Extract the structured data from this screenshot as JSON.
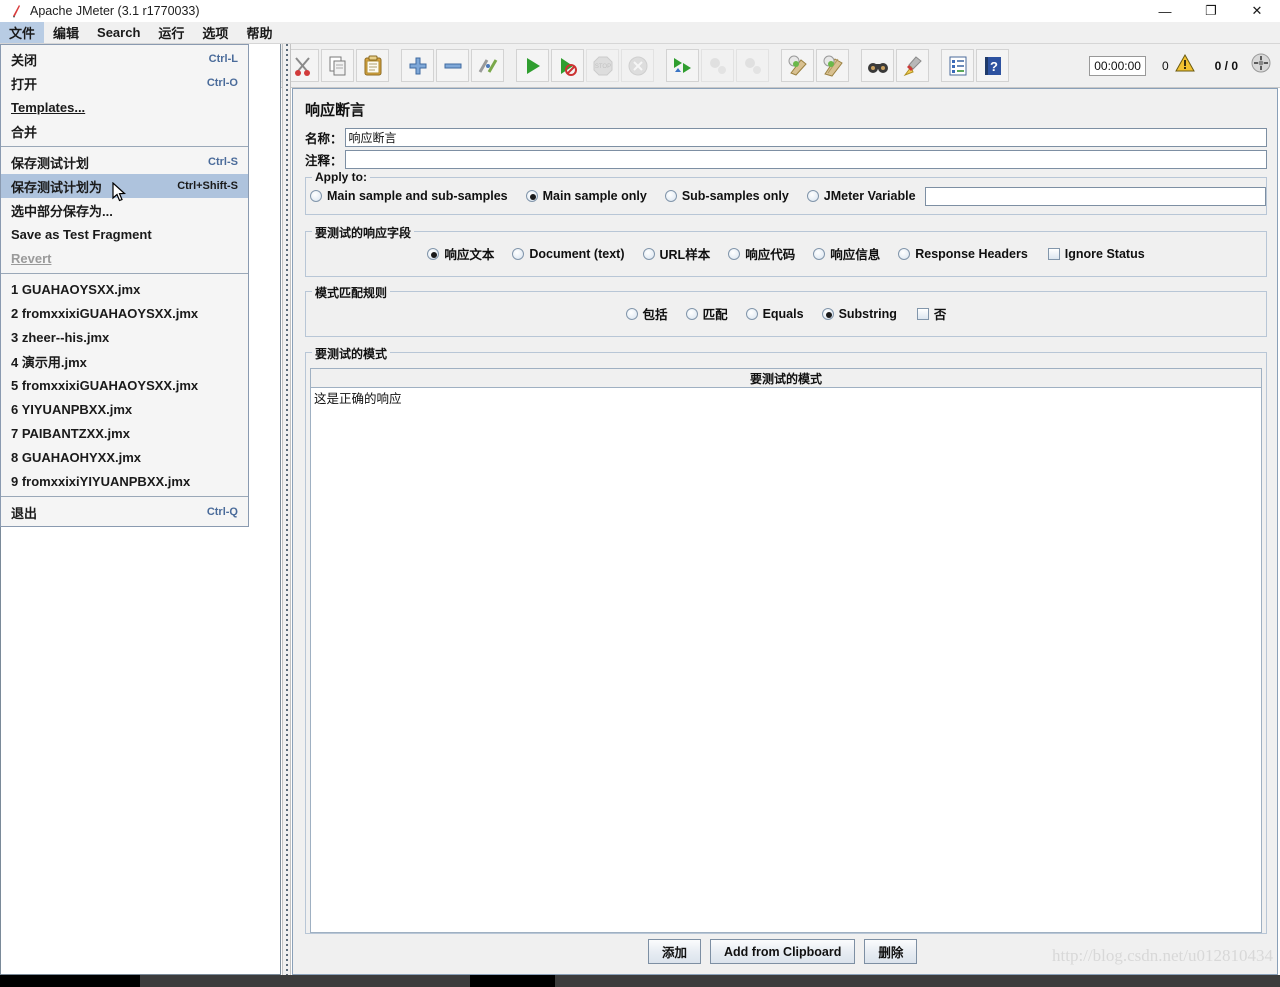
{
  "window": {
    "title": "Apache JMeter (3.1 r1770033)",
    "app_icon": "jmeter-feather-icon",
    "controls": {
      "minimize": "—",
      "restore": "❐",
      "close": "✕"
    }
  },
  "menubar": {
    "items": [
      {
        "label": "文件",
        "active": true
      },
      {
        "label": "编辑",
        "active": false
      },
      {
        "label": "Search",
        "active": false
      },
      {
        "label": "运行",
        "active": false
      },
      {
        "label": "选项",
        "active": false
      },
      {
        "label": "帮助",
        "active": false
      }
    ]
  },
  "file_menu": {
    "groups": [
      {
        "items": [
          {
            "label": "关闭",
            "accel": "Ctrl-L",
            "state": "normal"
          },
          {
            "label": "打开",
            "accel": "Ctrl-O",
            "state": "normal"
          },
          {
            "label": "Templates...",
            "accel": "",
            "state": "normal",
            "mnemonic": "T"
          },
          {
            "label": "合并",
            "accel": "",
            "state": "normal"
          }
        ]
      },
      {
        "items": [
          {
            "label": "保存测试计划",
            "accel": "Ctrl-S",
            "state": "normal"
          },
          {
            "label": "保存测试计划为",
            "accel": "Ctrl+Shift-S",
            "state": "selected"
          },
          {
            "label": "选中部分保存为...",
            "accel": "",
            "state": "normal"
          },
          {
            "label": "Save as Test Fragment",
            "accel": "",
            "state": "normal"
          },
          {
            "label": "Revert",
            "accel": "",
            "state": "disabled",
            "mnemonic": "R"
          }
        ]
      },
      {
        "items": [
          {
            "label": "1 GUAHAOYSXX.jmx",
            "accel": "",
            "state": "recent",
            "mnemonic": "1"
          },
          {
            "label": "2 fromxxixiGUAHAOYSXX.jmx",
            "accel": "",
            "state": "recent",
            "mnemonic": "2"
          },
          {
            "label": "3 zheer--his.jmx",
            "accel": "",
            "state": "recent",
            "mnemonic": "3"
          },
          {
            "label": "4 演示用.jmx",
            "accel": "",
            "state": "recent",
            "mnemonic": "4"
          },
          {
            "label": "5 fromxxixiGUAHAOYSXX.jmx",
            "accel": "",
            "state": "recent",
            "mnemonic": "5"
          },
          {
            "label": "6 YIYUANPBXX.jmx",
            "accel": "",
            "state": "recent",
            "mnemonic": "6"
          },
          {
            "label": "7 PAIBANTZXX.jmx",
            "accel": "",
            "state": "recent",
            "mnemonic": "7"
          },
          {
            "label": "8 GUAHAOHYXX.jmx",
            "accel": "",
            "state": "recent",
            "mnemonic": "8"
          },
          {
            "label": "9 fromxxixiYIYUANPBXX.jmx",
            "accel": "",
            "state": "recent",
            "mnemonic": "9"
          }
        ]
      },
      {
        "items": [
          {
            "label": "退出",
            "accel": "Ctrl-Q",
            "state": "normal"
          }
        ]
      }
    ]
  },
  "toolbar": {
    "buttons": [
      {
        "icon": "undo-icon",
        "enabled": false
      },
      {
        "icon": "cut-scissors-icon",
        "enabled": true
      },
      {
        "icon": "copy-icon",
        "enabled": true
      },
      {
        "icon": "paste-clipboard-icon",
        "enabled": true
      },
      {
        "icon": "expand-plus-icon",
        "enabled": true
      },
      {
        "icon": "collapse-minus-icon",
        "enabled": true
      },
      {
        "icon": "toggle-enable-icon",
        "enabled": true
      },
      {
        "icon": "start-play-icon",
        "enabled": true
      },
      {
        "icon": "start-no-timers-icon",
        "enabled": true
      },
      {
        "icon": "stop-icon",
        "enabled": false
      },
      {
        "icon": "shutdown-icon",
        "enabled": false
      },
      {
        "icon": "remote-start-all-icon",
        "enabled": true
      },
      {
        "icon": "remote-stop-all-icon",
        "enabled": false
      },
      {
        "icon": "remote-shutdown-all-icon",
        "enabled": false
      },
      {
        "icon": "clear-icon",
        "enabled": true
      },
      {
        "icon": "clear-all-icon",
        "enabled": true
      },
      {
        "icon": "search-binoculars-icon",
        "enabled": true
      },
      {
        "icon": "reset-search-broom-icon",
        "enabled": true
      },
      {
        "icon": "function-helper-icon",
        "enabled": true
      },
      {
        "icon": "help-book-icon",
        "enabled": true
      }
    ],
    "status": {
      "timer": "00:00:00",
      "warning_count": "0",
      "warning_icon": "warning-triangle-icon",
      "threads": "0 / 0",
      "clear_icon": "clear-gray-icon"
    }
  },
  "main": {
    "panel_title": "响应断言",
    "name_label": "名称：",
    "name_value": "响应断言",
    "comment_label": "注释：",
    "comment_value": "",
    "apply_to": {
      "title": "Apply to:",
      "options": [
        {
          "label": "Main sample and sub-samples",
          "selected": false
        },
        {
          "label": "Main sample only",
          "selected": true
        },
        {
          "label": "Sub-samples only",
          "selected": false
        },
        {
          "label": "JMeter Variable",
          "selected": false
        }
      ],
      "variable_value": ""
    },
    "response_field": {
      "title": "要测试的响应字段",
      "options": [
        {
          "label": "响应文本",
          "selected": true
        },
        {
          "label": "Document (text)",
          "selected": false
        },
        {
          "label": "URL样本",
          "selected": false
        },
        {
          "label": "响应代码",
          "selected": false
        },
        {
          "label": "响应信息",
          "selected": false
        },
        {
          "label": "Response Headers",
          "selected": false
        }
      ],
      "checkbox": {
        "label": "Ignore Status",
        "checked": false
      }
    },
    "pattern_rules": {
      "title": "模式匹配规则",
      "options": [
        {
          "label": "包括",
          "selected": false
        },
        {
          "label": "匹配",
          "selected": false
        },
        {
          "label": "Equals",
          "selected": false
        },
        {
          "label": "Substring",
          "selected": true
        }
      ],
      "checkbox": {
        "label": "否",
        "checked": false
      }
    },
    "patterns": {
      "title": "要测试的模式",
      "column_header": "要测试的模式",
      "rows": [
        "这是正确的响应"
      ]
    },
    "buttons": [
      {
        "label": "添加"
      },
      {
        "label": "Add from Clipboard"
      },
      {
        "label": "删除"
      }
    ]
  },
  "watermark": "http://blog.csdn.net/u012810434"
}
